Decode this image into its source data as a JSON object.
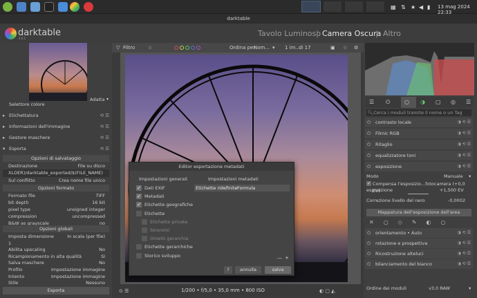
{
  "taskbar": {
    "datetime": "13 mag 2024 22:33"
  },
  "window": {
    "title": "darktable"
  },
  "header": {
    "logo": "darktable",
    "version": "4.6.1",
    "views": [
      "Tavolo Luminoso",
      "Camera Oscura",
      "Altro"
    ],
    "sep": "|"
  },
  "left": {
    "adapt": "Adatta",
    "modules": [
      "Selettore colore",
      "Etichettatura",
      "Informazioni dell'immagine",
      "Gestore maschere",
      "Esporta"
    ],
    "section_save": "Opzioni di salvataggio",
    "destination_label": "Destinazione",
    "destination_value": "File su disco",
    "path": "XLDER)/darktable_exported/$(FILE_NAME)",
    "conflict_label": "Sul conflitto",
    "conflict_value": "Crea nome file unico",
    "section_format": "Opzioni formato",
    "format_rows": [
      {
        "k": "Formato file",
        "v": "TIFF"
      },
      {
        "k": "bit depth",
        "v": "16 bit"
      },
      {
        "k": "pixel type",
        "v": "unsigned integer"
      },
      {
        "k": "compression",
        "v": "uncompressed"
      },
      {
        "k": "B&W as grayscale",
        "v": "no"
      }
    ],
    "section_global": "Opzioni globali",
    "global_rows": [
      {
        "k": "Imposta dimensione",
        "v": "In scala (per file)"
      },
      {
        "k": "1",
        "v": ""
      },
      {
        "k": "Abilita upscaling",
        "v": "No"
      },
      {
        "k": "Ricampionamento in alta qualità",
        "v": "Sì"
      },
      {
        "k": "Salva maschere",
        "v": "No"
      },
      {
        "k": "Profilo",
        "v": "Impostazione immagine"
      },
      {
        "k": "Intento",
        "v": "Impostazione immagine"
      },
      {
        "k": "Stile",
        "v": "Nessuno"
      }
    ],
    "export_button": "Esporta"
  },
  "toolbar": {
    "filter": "Filtro",
    "sort_label": "Ordina per",
    "sort_value": "Nom...",
    "count": "1 im...",
    "of": "di 17"
  },
  "bottombar": {
    "exif": "1/200 • f/5,0 • 35,0 mm • 800 ISO"
  },
  "dialog": {
    "title": "Editor esportazione metadati",
    "col1": "Impostazioni generali",
    "col2": "Impostazioni metadati",
    "items": [
      {
        "label": "Dati EXIF",
        "checked": true,
        "disabled": false
      },
      {
        "label": "Metadati",
        "checked": true,
        "disabled": false
      },
      {
        "label": "Etichette geografiche",
        "checked": true,
        "disabled": false
      },
      {
        "label": "Etichette",
        "checked": false,
        "disabled": false
      },
      {
        "label": "Etichette private",
        "checked": false,
        "disabled": true
      },
      {
        "label": "Sinonimi",
        "checked": false,
        "disabled": true
      },
      {
        "label": "Ometti gerarchia",
        "checked": false,
        "disabled": true
      },
      {
        "label": "Etichette gerarchiche",
        "checked": false,
        "disabled": false
      },
      {
        "label": "Storico sviluppo",
        "checked": false,
        "disabled": false
      }
    ],
    "table_col1": "Etichette ridefinite",
    "table_col2": "Formula",
    "help": "?",
    "cancel": "annulla",
    "save": "salva",
    "minus": "—",
    "plus": "+"
  },
  "right": {
    "search_placeholder": "Cerca i moduli tramite il nome o un Tag",
    "modules_top": [
      "contrasto locale",
      "Filmic RGB",
      "Ritaglio",
      "equalizzatore toni",
      "esposizione"
    ],
    "mode_label": "Modo",
    "mode_value": "Manuale",
    "compensate": "Compensa l'esposizio...fotocamera (+0,0 EV)",
    "exposure_label": "esposizione",
    "exposure_value": "+1,500 EV",
    "black_label": "Correzione livello del nero",
    "black_value": "-0,0002",
    "mapping_button": "Mappatura dell'esposizione dell'area",
    "modules_bottom": [
      "orientamento • Auto",
      "rotazione e prospettiva",
      "Ricostruzione alteluci",
      "bilanciamento del bianco"
    ],
    "order_label": "Ordine dei moduli",
    "order_value": "v3.0 RAW"
  }
}
